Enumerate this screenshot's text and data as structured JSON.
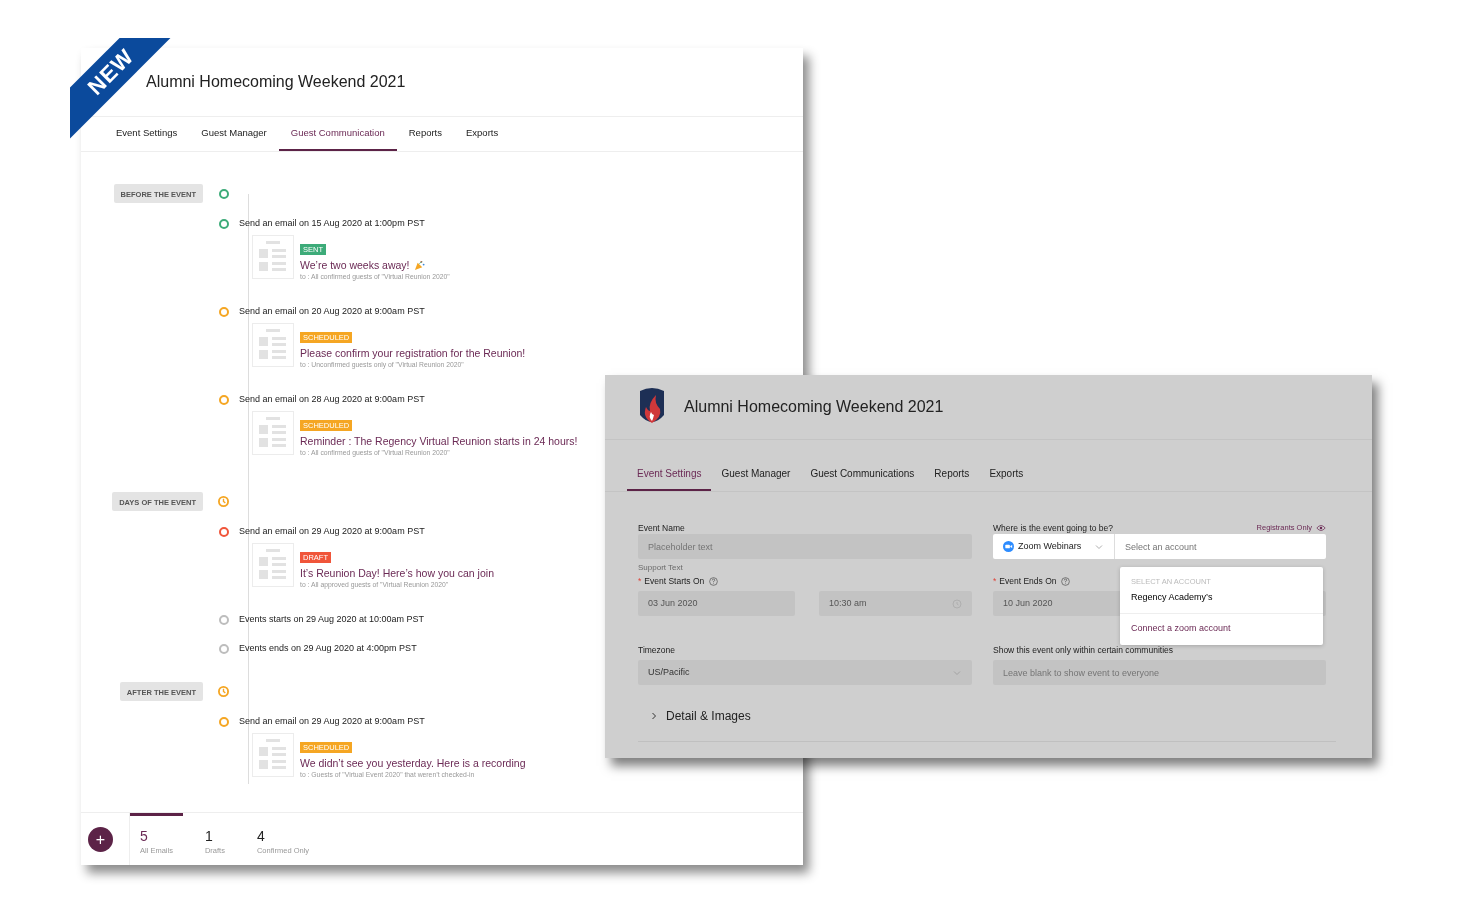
{
  "ribbon": {
    "text": "NEW"
  },
  "main_window": {
    "title": "Alumni Homecoming Weekend 2021",
    "tabs": [
      {
        "label": "Event Settings",
        "selected": false
      },
      {
        "label": "Guest Manager",
        "selected": false
      },
      {
        "label": "Guest Communication",
        "selected": true
      },
      {
        "label": "Reports",
        "selected": false
      },
      {
        "label": "Exports",
        "selected": false
      }
    ],
    "timeline": [
      {
        "kind": "section",
        "label": "BEFORE THE EVENT",
        "clock": false,
        "color": "#3dab79"
      },
      {
        "kind": "email",
        "text": "Send an email on 15 Aug 2020 at 1:00pm PST",
        "color": "#3dab79",
        "status": "SENT",
        "subject": "We’re two weeks away!",
        "party_icon": true,
        "recipients": "to : All confirmed guests of \"Virtual Reunion 2020\""
      },
      {
        "kind": "email",
        "text": "Send an email on 20 Aug 2020 at 9:00am PST",
        "color": "#f5a623",
        "status": "SCHEDULED",
        "subject": "Please confirm your registration for the Reunion!",
        "recipients": "to : Unconfirmed guests only of \"Virtual Reunion 2020\""
      },
      {
        "kind": "email",
        "text": "Send an email on 28 Aug 2020 at 9:00am PST",
        "color": "#f5a623",
        "status": "SCHEDULED",
        "subject": "Reminder : The Regency Virtual Reunion starts in 24 hours!",
        "recipients": "to : All confirmed guests of \"Virtual Reunion 2020\""
      },
      {
        "kind": "section",
        "label": "DAYS OF THE EVENT",
        "clock": true,
        "color": "#f5a623"
      },
      {
        "kind": "email",
        "text": "Send an email on 29 Aug 2020 at 9:00am PST",
        "color": "#f0553a",
        "status": "DRAFT",
        "subject": "It’s Reunion Day! Here’s how you can join",
        "recipients": "to : All approved guests of \"Virtual Reunion 2020\""
      },
      {
        "kind": "event",
        "text": "Events starts on 29 Aug 2020 at 10:00am PST",
        "color": "#bdbdbd"
      },
      {
        "kind": "event",
        "text": "Events ends on 29 Aug 2020 at 4:00pm PST",
        "color": "#bdbdbd"
      },
      {
        "kind": "section",
        "label": "AFTER THE EVENT",
        "clock": true,
        "color": "#f5a623"
      },
      {
        "kind": "email",
        "text": "Send an email on 29 Aug 2020 at 9:00am PST",
        "color": "#f5a623",
        "status": "SCHEDULED",
        "subject": "We didn’t see you yesterday. Here is a recording",
        "recipients": "to :  Guests of \"Virtual Event 2020\" that weren’t checked-in"
      }
    ],
    "add_button": {
      "text": "+"
    },
    "stats": [
      {
        "value": "5",
        "label": "All Emails",
        "selected": true
      },
      {
        "value": "1",
        "label": "Drafts",
        "selected": false
      },
      {
        "value": "4",
        "label": "Confirmed Only",
        "selected": false
      }
    ]
  },
  "settings_window": {
    "title": "Alumni Homecoming Weekend 2021",
    "tabs": [
      {
        "label": "Event Settings",
        "selected": true
      },
      {
        "label": "Guest Manager",
        "selected": false
      },
      {
        "label": "Guest Communications",
        "selected": false
      },
      {
        "label": "Reports",
        "selected": false
      },
      {
        "label": "Exports",
        "selected": false
      }
    ],
    "event_name": {
      "label": "Event Name",
      "placeholder": "Placeholder text",
      "support_text": "Support Text"
    },
    "starts_on": {
      "required_mark": "*",
      "label": "Event Starts On",
      "date": "03 Jun 2020",
      "time": "10:30 am"
    },
    "timezone": {
      "label": "Timezone",
      "value": "US/Pacific"
    },
    "location": {
      "label": "Where is the event going to be?",
      "visibility": "Registrants Only",
      "platform": "Zoom Webinars",
      "account_placeholder": "Select an account"
    },
    "ends_on": {
      "required_mark": "*",
      "label": "Event Ends On",
      "date": "10 Jun 2020"
    },
    "communities": {
      "label": "Show this event only within certain communities",
      "placeholder": "Leave blank to show event to everyone"
    },
    "account_menu": {
      "header": "SELECT AN ACCOUNT",
      "options": [
        "Regency Academy’s"
      ],
      "action": "Connect a zoom account"
    },
    "details": {
      "label": "Detail & Images",
      "expanded": false
    }
  }
}
